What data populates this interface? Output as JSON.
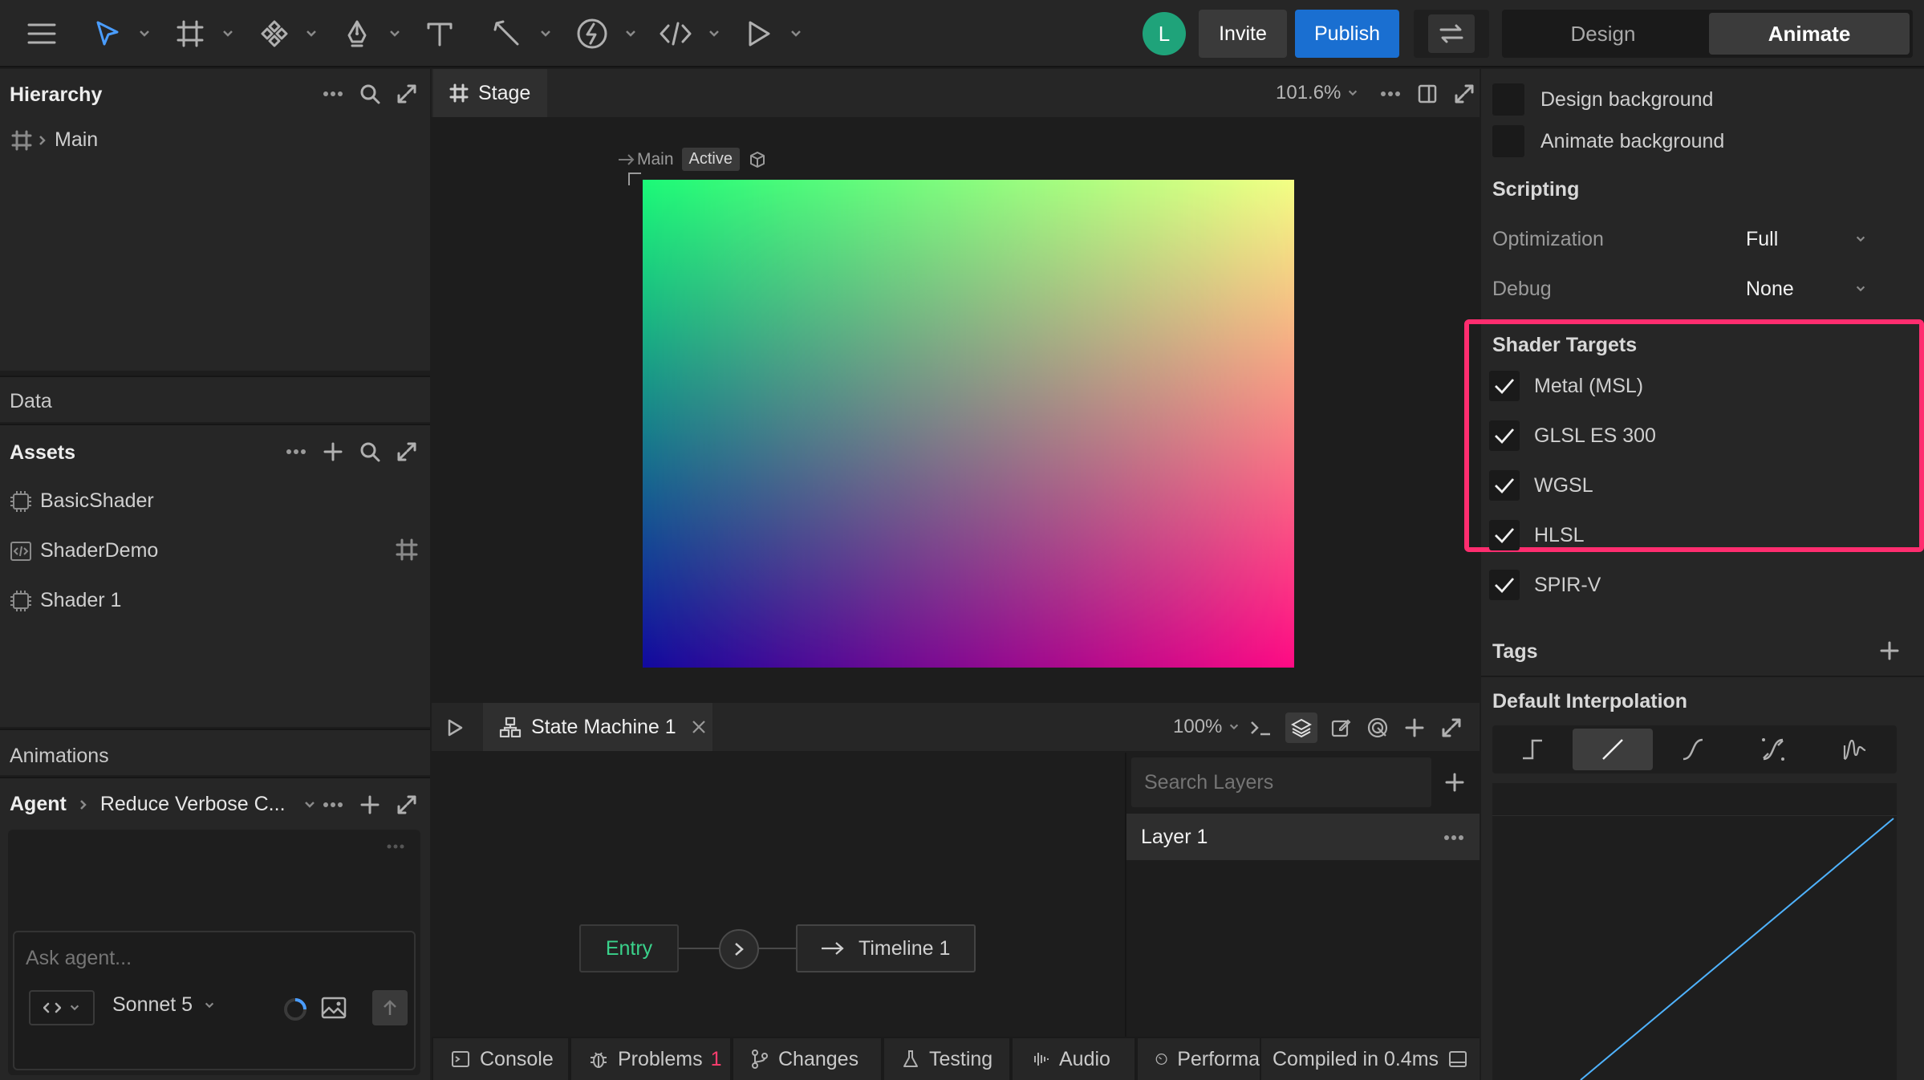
{
  "toolbar": {
    "avatar_letter": "L",
    "invite_label": "Invite",
    "publish_label": "Publish",
    "mode_tabs": [
      "Design",
      "Animate"
    ],
    "active_mode": "Animate"
  },
  "hierarchy": {
    "title": "Hierarchy",
    "root_item": "Main"
  },
  "data_panel": {
    "title": "Data"
  },
  "assets": {
    "title": "Assets",
    "items": [
      "BasicShader",
      "ShaderDemo",
      "Shader 1"
    ]
  },
  "animations": {
    "title": "Animations"
  },
  "agent": {
    "title": "Agent",
    "conversation": "Reduce Verbose C...",
    "input_placeholder": "Ask agent...",
    "model": "Sonnet 5"
  },
  "stage": {
    "tab_label": "Stage",
    "zoom": "101.6%",
    "artboard_name": "Main",
    "artboard_badge": "Active",
    "gradient_colors": {
      "top_left": "#1bfa78",
      "top_right": "#f4ff84",
      "bottom_left": "#120a9e",
      "bottom_right": "#ff0a84"
    }
  },
  "state_machine": {
    "tab_label": "State Machine 1",
    "zoom": "100%",
    "entry_label": "Entry",
    "timeline_label": "Timeline 1",
    "search_placeholder": "Search Layers",
    "layer_name": "Layer 1"
  },
  "bottom_bar": {
    "console": "Console",
    "problems": "Problems",
    "problems_count": "1",
    "changes": "Changes",
    "testing": "Testing",
    "audio": "Audio",
    "performance": "Performa",
    "compiled": "Compiled in 0.4ms"
  },
  "inspector": {
    "design_background": "Design background",
    "animate_background": "Animate background",
    "scripting_title": "Scripting",
    "optimization_label": "Optimization",
    "optimization_value": "Full",
    "debug_label": "Debug",
    "debug_value": "None",
    "shader_targets_title": "Shader Targets",
    "shader_targets": [
      {
        "label": "Metal (MSL)",
        "checked": true
      },
      {
        "label": "GLSL ES 300",
        "checked": true
      },
      {
        "label": "WGSL",
        "checked": true
      },
      {
        "label": "HLSL",
        "checked": true
      },
      {
        "label": "SPIR-V",
        "checked": true
      }
    ],
    "tags_title": "Tags",
    "interpolation_title": "Default Interpolation",
    "interpolation_selected": "linear"
  },
  "colors": {
    "accent_blue": "#1a6fd1",
    "highlight_pink": "#ff2d6f",
    "avatar_green": "#1fa37a",
    "entry_green": "#3ad28b"
  }
}
